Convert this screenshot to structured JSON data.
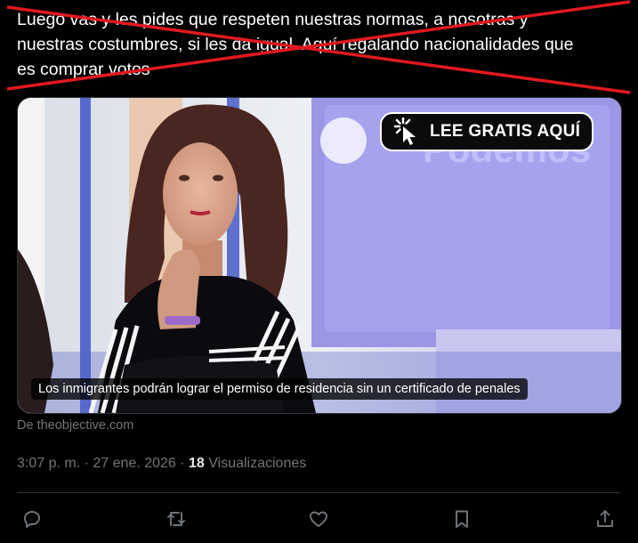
{
  "tweet": {
    "text": "Luego vas y les pides que respeten nuestras normas, a nosotras y\nnuestras costumbres, si les da igual. Aquí regalando nacionalidades que\nes comprar votos"
  },
  "card": {
    "cta_label": "LEE GRATIS AQUÍ",
    "caption": "Los inmigrantes podrán lograr el permiso de residencia sin un certificado de penales",
    "source": "De theobjective.com"
  },
  "meta": {
    "time": "3:07 p. m.",
    "separator1": " · ",
    "date": "27 ene. 2026",
    "separator2": " · ",
    "views_count": "18",
    "views_label": " Visualizaciones"
  },
  "colors": {
    "background": "#000000",
    "text": "#ffffff",
    "secondary": "#71767b",
    "strike": "#e0191f",
    "divider": "#2f3336"
  },
  "icons": {
    "reply": "reply-icon",
    "retweet": "retweet-icon",
    "like": "heart-icon",
    "bookmark": "bookmark-icon",
    "share": "share-icon",
    "cta": "cursor-click-icon"
  }
}
